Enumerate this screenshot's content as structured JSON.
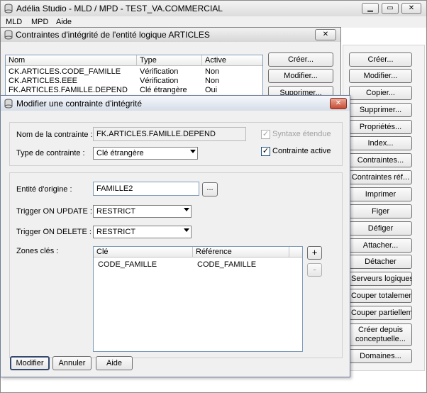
{
  "main_window": {
    "title": "Adélia Studio - MLD / MPD - TEST_VA.COMMERCIAL",
    "menu": [
      "MLD",
      "MPD",
      "Aide"
    ],
    "buttons": [
      "Créer...",
      "Modifier...",
      "Copier...",
      "Supprimer...",
      "Propriétés...",
      "Index...",
      "Contraintes...",
      "Contraintes réf...",
      "Imprimer",
      "Figer",
      "Défiger",
      "Attacher...",
      "Détacher",
      "Serveurs logiques...",
      "Couper totalement",
      "Couper partiellement",
      "Créer depuis conceptuelle...",
      "Domaines..."
    ]
  },
  "constraints_window": {
    "title": "Contraintes d'intégrité de l'entité logique ARTICLES",
    "columns": [
      "Nom",
      "Type",
      "Active"
    ],
    "rows": [
      {
        "name": "CK.ARTICLES.CODE_FAMILLE",
        "type": "Vérification",
        "active": "Non"
      },
      {
        "name": "CK.ARTICLES.EEE",
        "type": "Vérification",
        "active": "Non"
      },
      {
        "name": "FK.ARTICLES.FAMILLE.DEPEND",
        "type": "Clé étrangère",
        "active": "Oui"
      }
    ],
    "buttons": {
      "create": "Créer...",
      "modify": "Modifier...",
      "delete": "Supprimer..."
    }
  },
  "modify_dialog": {
    "title": "Modifier une contrainte d'intégrité",
    "constraint_name_label": "Nom de la contrainte :",
    "constraint_name_value": "FK.ARTICLES.FAMILLE.DEPEND",
    "extended_syntax_label": "Syntaxe étendue",
    "constraint_type_label": "Type de contrainte :",
    "constraint_type_value": "Clé étrangère",
    "active_label": "Contrainte active",
    "origin_entity_label": "Entité d'origine :",
    "origin_entity_value": "FAMILLE2",
    "browse_label": "...",
    "on_update_label": "Trigger ON UPDATE :",
    "on_update_value": "RESTRICT",
    "on_delete_label": "Trigger ON DELETE :",
    "on_delete_value": "RESTRICT",
    "keys_label": "Zones clés :",
    "keys_columns": [
      "Clé",
      "Référence"
    ],
    "keys_rows": [
      {
        "key": "CODE_FAMILLE",
        "reference": "CODE_FAMILLE"
      }
    ],
    "add_label": "+",
    "remove_label": "-",
    "buttons": {
      "modify": "Modifier",
      "cancel": "Annuler",
      "help": "Aide"
    }
  }
}
